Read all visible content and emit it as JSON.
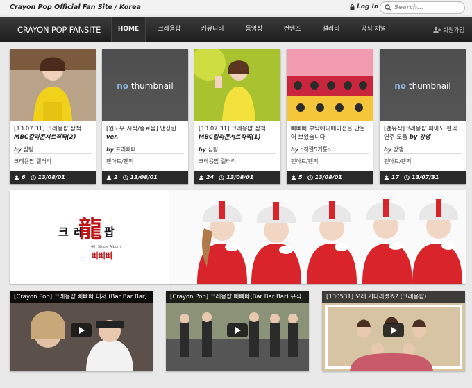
{
  "topbar": {
    "site_title": "Crayon Pop Official Fan Site / Korea",
    "login_label": "Log In",
    "search_placeholder": "Search..."
  },
  "nav": {
    "brand": "CRAYON POP FANSITE",
    "items": [
      {
        "label": "HOME",
        "active": true
      },
      {
        "label": "크레용팝"
      },
      {
        "label": "커뮤니티"
      },
      {
        "label": "동영상"
      },
      {
        "label": "컨텐츠"
      },
      {
        "label": "갤러리"
      },
      {
        "label": "공식 채널"
      }
    ],
    "signup_label": "회원가입"
  },
  "cards": [
    {
      "thumb": "photo-yellow-stage",
      "title_plain": "[13.07.31] 크레용팝 삼척",
      "title_bold": "MBC칼라콘서트직찍(2)",
      "by_prefix": "by",
      "author": "심팅",
      "category": "크레용팝 갤러리",
      "views": "6",
      "date": "13/08/01"
    },
    {
      "thumb": "no-thumbnail",
      "title_plain": "[원도우 시작/종료음] 댄싱퀸",
      "title_bold": "ver.",
      "by_prefix": "by",
      "author": "프리빠빠",
      "category": "팬아트/팬픽",
      "views": "2",
      "date": "13/08/01"
    },
    {
      "thumb": "photo-yellow-stage2",
      "title_plain": "[13.07.31] 크레용팝 삼척",
      "title_bold": "MBC칼라콘서트직찍(1)",
      "by_prefix": "by",
      "author": "심팅",
      "category": "크레용팝 갤러리",
      "views": "24",
      "date": "13/08/01"
    },
    {
      "thumb": "photo-collage",
      "title_plain": "빠빠빠 부탁에니메이션을 만들어 보았습니다",
      "title_bold": "",
      "by_prefix": "by",
      "author": "o직렬5기통o",
      "category": "팬아트/팬픽",
      "views": "5",
      "date": "13/08/01"
    },
    {
      "thumb": "no-thumbnail",
      "title_plain": "[팬유작]크레용팝 피아노 편곡 연주 모음",
      "title_bold": "by 강앵",
      "by_prefix": "by",
      "author": "강앵",
      "category": "팬아트/팬픽",
      "views": "17",
      "date": "13/07/31"
    }
  ],
  "no_thumb": {
    "no": "no",
    "thumbnail": "thumbnail"
  },
  "banner": {
    "title_left": "크 레",
    "title_mid": "龍",
    "title_right": "팝",
    "album_text": "4th Single Album",
    "song": "빠빠빠"
  },
  "videos": [
    {
      "title": "[Crayon Pop] 크레용팝 빠빠빠 티저 (Bar Bar Bar)"
    },
    {
      "title": "[Crayon Pop] 크레용팝 빠빠빠(Bar Bar Bar) 뮤직"
    },
    {
      "title": "[130531] 오래 기다리셨죠? (크레용팝)"
    }
  ],
  "colors": {
    "accent_red": "#c0161a",
    "nav_dark": "#2a2a2a",
    "link_blue": "#8fb6e0"
  },
  "icons": {
    "views": "people-icon",
    "date": "clock-icon",
    "login": "lock-icon",
    "search": "search-icon",
    "signup": "user-add-icon",
    "video": "play-icon"
  }
}
